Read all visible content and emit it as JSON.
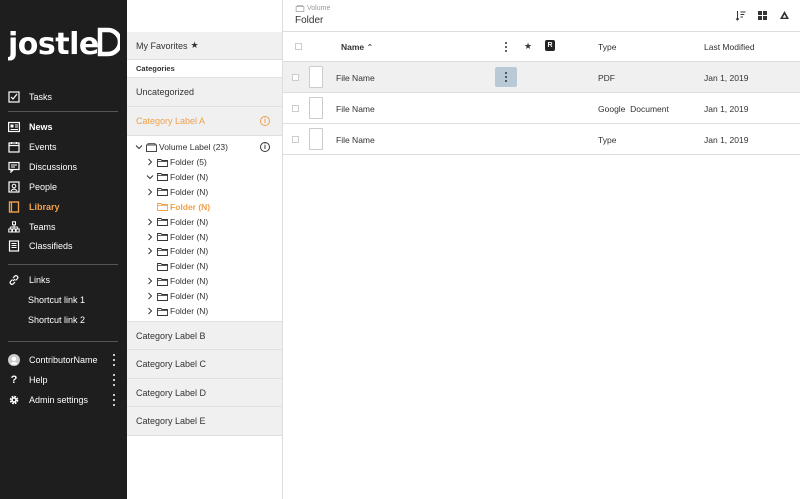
{
  "nav": {
    "logo": "jostle",
    "items": [
      {
        "label": "Tasks",
        "icon": "tasks-icon"
      },
      {
        "label": "News",
        "icon": "news-icon"
      },
      {
        "label": "Events",
        "icon": "events-icon"
      },
      {
        "label": "Discussions",
        "icon": "discussions-icon"
      },
      {
        "label": "People",
        "icon": "people-icon"
      },
      {
        "label": "Library",
        "icon": "library-icon"
      },
      {
        "label": "Teams",
        "icon": "teams-icon"
      },
      {
        "label": "Classifieds",
        "icon": "classifieds-icon"
      },
      {
        "label": "Links",
        "icon": "link-icon"
      }
    ],
    "shortcuts": [
      "Shortcut link 1",
      "Shortcut link 2"
    ],
    "user": "ContributorName",
    "help": "Help",
    "admin": "Admin settings",
    "active_color": "#f0a04b"
  },
  "categories": {
    "favorites": "My Favorites",
    "heading": "Categories",
    "uncategorized": "Uncategorized",
    "active_label": "Category Label A",
    "volume": "Volume Label (23)",
    "folders": [
      {
        "label": "Folder (5)",
        "chevron": "right"
      },
      {
        "label": "Folder (N)",
        "chevron": "down"
      },
      {
        "label": "Folder (N)",
        "chevron": "right"
      },
      {
        "label": "Folder (N)",
        "chevron": "none"
      },
      {
        "label": "Folder (N)",
        "chevron": "right"
      },
      {
        "label": "Folder (N)",
        "chevron": "right"
      },
      {
        "label": "Folder (N)",
        "chevron": "right"
      },
      {
        "label": "Folder (N)",
        "chevron": "none"
      },
      {
        "label": "Folder (N)",
        "chevron": "right"
      },
      {
        "label": "Folder (N)",
        "chevron": "right"
      },
      {
        "label": "Folder (N)",
        "chevron": "right"
      }
    ],
    "others": [
      "Category Label B",
      "Category Label C",
      "Category Label D",
      "Category Label E"
    ]
  },
  "main": {
    "breadcrumb": "Volume",
    "title": "Folder",
    "columns": {
      "name": "Name",
      "type": "Type",
      "modified": "Last Modified",
      "r_badge": "R"
    },
    "rows": [
      {
        "name": "File Name",
        "type": "PDF",
        "modified": "Jan 1, 2019"
      },
      {
        "name": "File Name",
        "type": "Google  Document",
        "modified": "Jan 1, 2019"
      },
      {
        "name": "File Name",
        "type": "Type",
        "modified": "Jan 1, 2019"
      }
    ]
  }
}
